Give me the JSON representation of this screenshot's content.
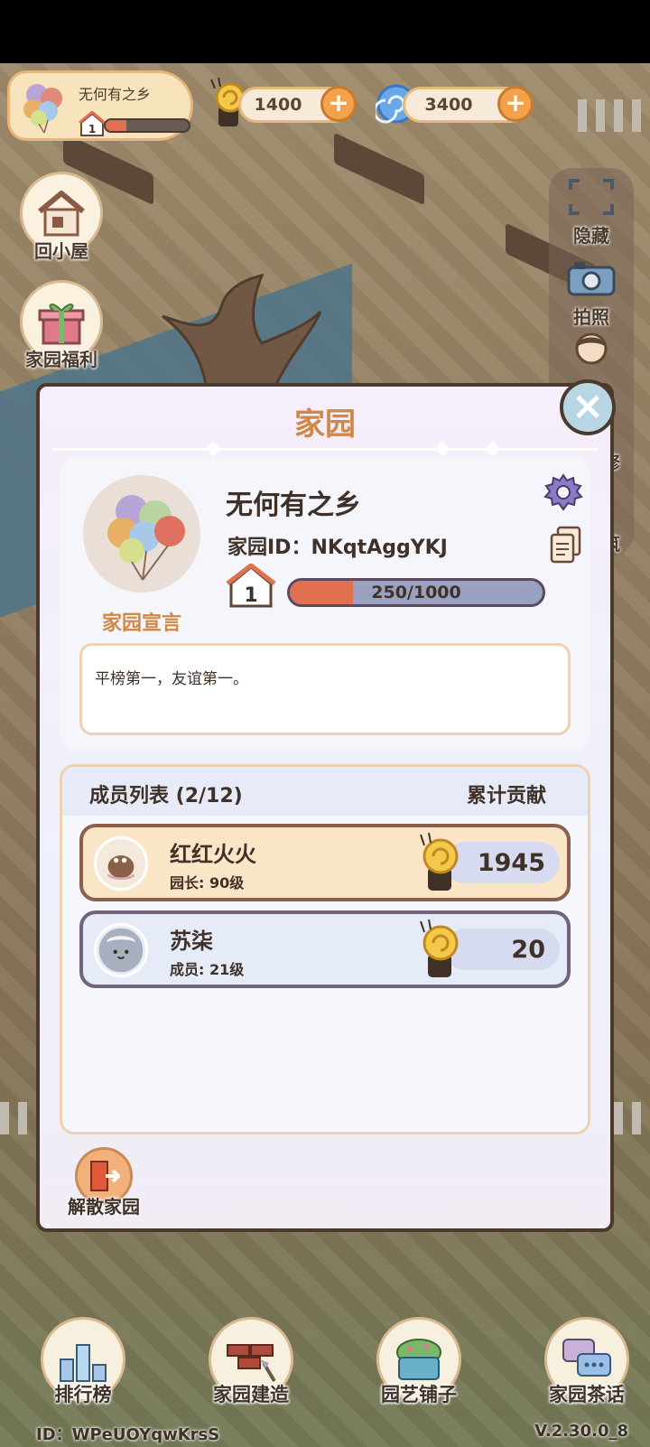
{
  "home_card": {
    "name": "无何有之乡",
    "level": "1",
    "progress": 0.25
  },
  "currencies": [
    {
      "icon": "snail-coin-icon",
      "value": "1400"
    },
    {
      "icon": "swirl-gem-icon",
      "value": "3400"
    }
  ],
  "left_buttons": [
    {
      "label": "回小屋",
      "icon": "house-icon"
    },
    {
      "label": "家园福利",
      "icon": "gift-icon"
    }
  ],
  "right_panel": [
    {
      "label": "隐藏",
      "icon": "hide-frame-icon"
    },
    {
      "label": "拍照",
      "icon": "camera-icon"
    },
    {
      "label": "修",
      "icon": "character-icon"
    },
    {
      "label": "筑",
      "icon": "build-icon"
    }
  ],
  "modal": {
    "title": "家园",
    "home_name": "无何有之乡",
    "home_id": "家园ID：NKqtAggYKJ",
    "level": "1",
    "exp_text": "250/1000",
    "exp_fraction": 0.25,
    "declaration_label": "家园宣言",
    "declaration": "平榜第一，友谊第一。",
    "members_header": "成员列表 (2/12)",
    "contribution_header": "累计贡献",
    "members": [
      {
        "name": "红红火火",
        "rank": "园长: 90级",
        "score": "1945"
      },
      {
        "name": "苏柒",
        "rank": "成员: 21级",
        "score": "20"
      }
    ],
    "disband_label": "解散家园"
  },
  "bottom_nav": [
    {
      "label": "排行榜",
      "icon": "leaderboard-icon"
    },
    {
      "label": "家园建造",
      "icon": "brick-build-icon"
    },
    {
      "label": "园艺铺子",
      "icon": "plant-shop-icon"
    },
    {
      "label": "家园茶话",
      "icon": "chat-bubbles-icon"
    }
  ],
  "footer": {
    "id": "ID：WPeUOYqwKrsS",
    "version": "V.2.30.0_8"
  },
  "colors": {
    "accent": "#d08848",
    "exp_fill": "#e07050",
    "modal_border": "#4a3a2e"
  }
}
